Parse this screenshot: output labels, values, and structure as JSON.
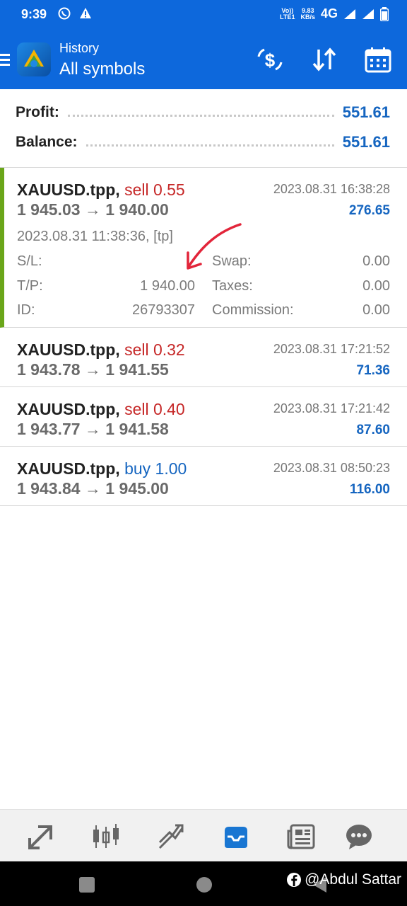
{
  "status_bar": {
    "time": "9:39",
    "volte": "Vo))\nLTE1",
    "net_speed": "9.83\nKB/s",
    "network": "4G"
  },
  "header": {
    "subtitle": "History",
    "title": "All symbols",
    "icons": [
      "menu-icon",
      "app-logo",
      "deposit-dollar-icon",
      "sort-arrows-icon",
      "calendar-icon"
    ]
  },
  "summary": {
    "profit_label": "Profit:",
    "profit_value": "551.61",
    "balance_label": "Balance:",
    "balance_value": "551.61"
  },
  "deals": [
    {
      "symbol": "XAUUSD.tpp,",
      "side": "sell 0.55",
      "time": "2023.08.31 16:38:28",
      "prices": "1 945.03 → 1 940.00",
      "profit": "276.65",
      "open_time": "2023.08.31 11:38:36, [tp]",
      "sl_label": "S/L:",
      "sl_value": "",
      "tp_label": "T/P:",
      "tp_value": "1 940.00",
      "id_label": "ID:",
      "id_value": "26793307",
      "swap_label": "Swap:",
      "swap_value": "0.00",
      "taxes_label": "Taxes:",
      "taxes_value": "0.00",
      "commission_label": "Commission:",
      "commission_value": "0.00"
    },
    {
      "symbol": "XAUUSD.tpp,",
      "side": "sell 0.32",
      "time": "2023.08.31 17:21:52",
      "prices": "1 943.78 → 1 941.55",
      "profit": "71.36"
    },
    {
      "symbol": "XAUUSD.tpp,",
      "side": "sell 0.40",
      "time": "2023.08.31 17:21:42",
      "prices": "1 943.77 → 1 941.58",
      "profit": "87.60"
    },
    {
      "symbol": "XAUUSD.tpp,",
      "side": "buy 1.00",
      "time": "2023.08.31 08:50:23",
      "prices": "1 943.84 → 1 945.00",
      "profit": "116.00"
    }
  ],
  "bottom_nav": [
    "quotes-icon",
    "chart-candles-icon",
    "trade-icon",
    "history-inbox-icon",
    "news-icon",
    "messages-icon"
  ],
  "watermark": "@Abdul Sattar",
  "colors": {
    "brand_blue": "#0d68dc",
    "profit_blue": "#1565c0",
    "sell_red": "#c62828",
    "expanded_bar": "#6aa61a"
  }
}
